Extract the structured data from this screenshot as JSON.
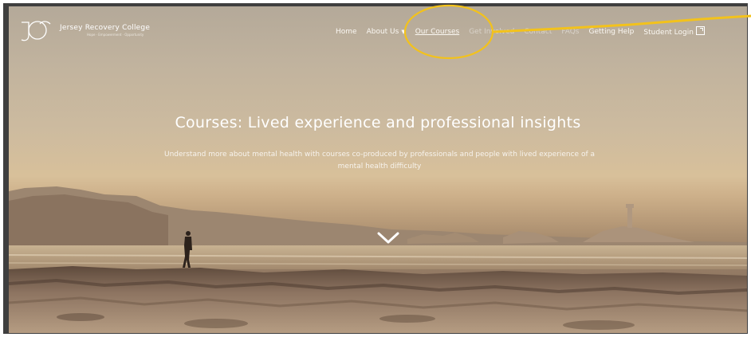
{
  "brand": {
    "name": "Jersey Recovery College",
    "tagline": "Hope · Empowerment · Opportunity",
    "logo_letters": "JRC"
  },
  "nav": {
    "items": [
      {
        "label": "Home"
      },
      {
        "label": "About Us"
      },
      {
        "label": "Our Courses"
      },
      {
        "label": "Get Involved"
      },
      {
        "label": "Contact"
      },
      {
        "label": "FAQs"
      },
      {
        "label": "Getting Help"
      },
      {
        "label": "Student Login"
      }
    ]
  },
  "hero": {
    "title": "Courses: Lived experience and professional insights",
    "subtitle": "Understand more about mental health with courses co-produced by professionals and people with lived experience of a mental health difficulty"
  },
  "icons": {
    "about_dropdown": "chevron-down-icon",
    "student_login": "external-link-icon",
    "scroll": "chevron-down-icon"
  },
  "colors": {
    "annotation": "#f3c21b",
    "nav_text": "#ffffff"
  }
}
